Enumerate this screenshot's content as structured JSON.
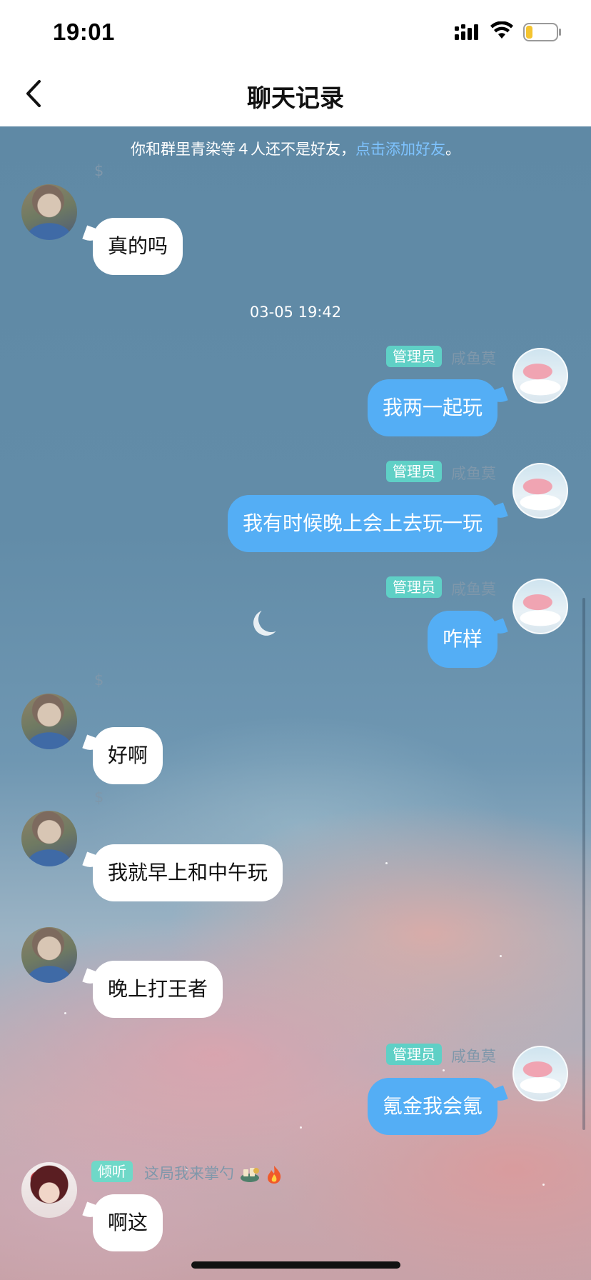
{
  "status_bar": {
    "time": "19:01"
  },
  "nav": {
    "title": "聊天记录"
  },
  "notice": {
    "text": "你和群里青染等４人还不是好友，",
    "link": "点击添加好友",
    "suffix": "。"
  },
  "messages": [
    {
      "sender": "$",
      "side": "in",
      "text": "真的吗"
    },
    {
      "timestamp": "03-05 19:42"
    },
    {
      "sender": "咸鱼莫",
      "badge": "管理员",
      "side": "out",
      "text": "我两一起玩"
    },
    {
      "sender": "咸鱼莫",
      "badge": "管理员",
      "side": "out",
      "text": "我有时候晚上会上去玩一玩"
    },
    {
      "sender": "咸鱼莫",
      "badge": "管理员",
      "side": "out",
      "text": "咋样"
    },
    {
      "sender": "$",
      "side": "in",
      "text": "好啊"
    },
    {
      "sender": "$",
      "side": "in",
      "text": "我就早上和中午玩"
    },
    {
      "sender": "",
      "side": "in",
      "text": "晚上打王者"
    },
    {
      "sender": "咸鱼莫",
      "badge": "管理员",
      "side": "out",
      "text": "氪金我会氪"
    },
    {
      "sender": "这局我来掌勺",
      "badge": "倾听",
      "side": "in",
      "text": "啊这"
    }
  ],
  "colors": {
    "outgoing_bubble": "#54aef5",
    "incoming_bubble": "#ffffff",
    "badge_admin": "#5fd0c6",
    "notice_link": "#7ec3ff"
  }
}
